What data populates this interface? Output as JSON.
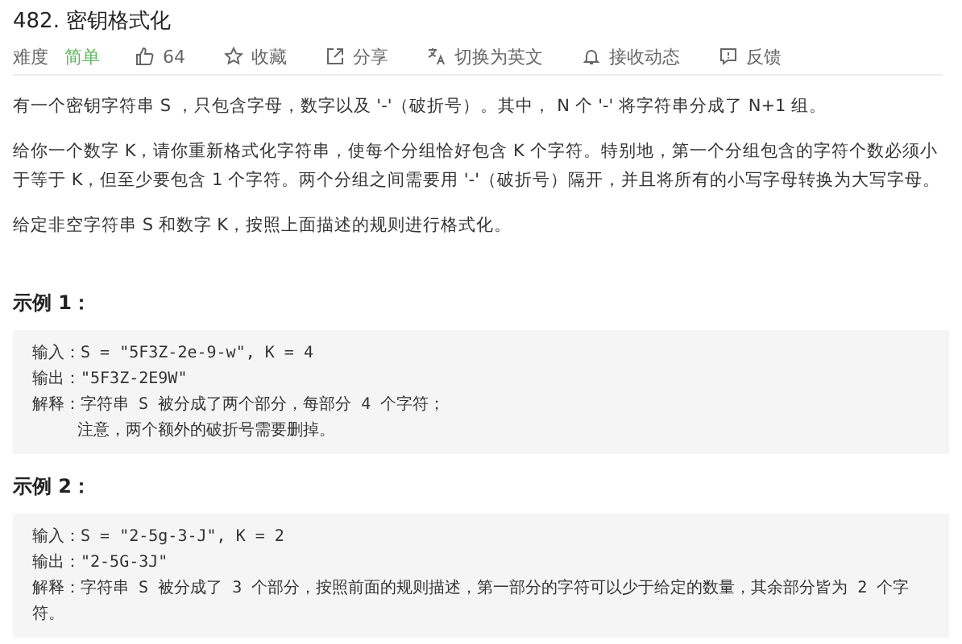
{
  "title": "482. 密钥格式化",
  "difficulty": {
    "label": "难度",
    "value": "简单"
  },
  "actions": [
    {
      "kind": "like",
      "label": "64"
    },
    {
      "kind": "star",
      "label": "收藏"
    },
    {
      "kind": "share",
      "label": "分享"
    },
    {
      "kind": "translate",
      "label": "切换为英文"
    },
    {
      "kind": "bell",
      "label": "接收动态"
    },
    {
      "kind": "feedback",
      "label": "反馈"
    }
  ],
  "paragraphs": [
    "有一个密钥字符串 S ，只包含字母，数字以及 '-'（破折号）。其中， N 个 '-' 将字符串分成了 N+1 组。",
    "给你一个数字 K，请你重新格式化字符串，使每个分组恰好包含 K 个字符。特别地，第一个分组包含的字符个数必须小于等于 K，但至少要包含 1 个字符。两个分组之间需要用 '-'（破折号）隔开，并且将所有的小写字母转换为大写字母。",
    "给定非空字符串 S 和数字 K，按照上面描述的规则进行格式化。"
  ],
  "examples": [
    {
      "heading": "示例 1：",
      "lines": [
        {
          "kind": "line",
          "text": "输入：S = \"5F3Z-2e-9-w\", K = 4"
        },
        {
          "kind": "line",
          "text": "输出：\"5F3Z-2E9W\""
        },
        {
          "kind": "line",
          "text": "解释：字符串 S 被分成了两个部分，每部分 4 个字符；"
        },
        {
          "kind": "continuation",
          "text": "注意，两个额外的破折号需要删掉。"
        }
      ]
    },
    {
      "heading": "示例 2：",
      "lines": [
        {
          "kind": "line",
          "text": "输入：S = \"2-5g-3-J\", K = 2"
        },
        {
          "kind": "line",
          "text": "输出：\"2-5G-3J\""
        },
        {
          "kind": "line",
          "text": "解释：字符串 S 被分成了 3 个部分，按照前面的规则描述，第一部分的字符可以少于给定的数量，其余部分皆为 2 个字符。"
        }
      ]
    }
  ]
}
